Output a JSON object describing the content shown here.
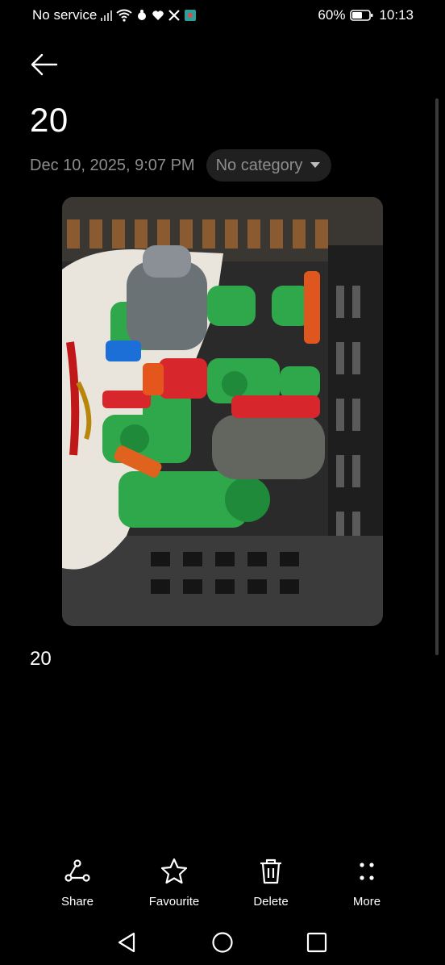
{
  "status_bar": {
    "carrier": "No service",
    "battery": "60%",
    "time": "10:13"
  },
  "note": {
    "title": "20",
    "date": "Dec 10, 2025, 9:07 PM",
    "category": "No category",
    "body_text": "20"
  },
  "actions": {
    "share": "Share",
    "favourite": "Favourite",
    "delete": "Delete",
    "more": "More"
  }
}
